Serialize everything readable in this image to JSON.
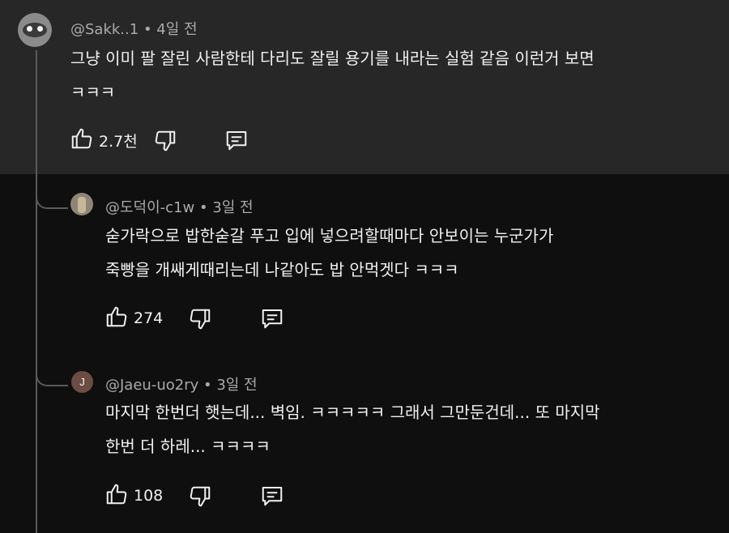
{
  "comments": [
    {
      "author": "@Sakk..1",
      "time": "• 4일 전",
      "lines": [
        "그냥 이미 팔 잘린 사람한테 다리도 잘릴 용기를 내라는 실험 같음 이런거 보면",
        "ㅋㅋㅋ"
      ],
      "likes": "2.7천"
    },
    {
      "author": "@도덕이-c1w",
      "time": "• 3일 전",
      "lines": [
        "숟가락으로  밥한숟갈 푸고 입에 넣으려할때마다 안보이는 누군가가",
        "죽빵을 개쌔게때리는데 나같아도 밥 안먹겟다 ㅋㅋㅋ"
      ],
      "likes": "274"
    },
    {
      "author": "@Jaeu-uo2ry",
      "avatar_letter": "J",
      "time": "• 3일 전",
      "lines": [
        "마지막 한번더 햇는데... 벽임. ㅋㅋㅋㅋㅋ 그래서 그만둔건데... 또 마지막",
        "한번 더 하레... ㅋㅋㅋㅋ"
      ],
      "likes": "108"
    }
  ],
  "colors": {
    "highlight_bg": "#272727",
    "page_bg": "#0f0f0f",
    "meta": "#aaaaaa",
    "text": "#f1f1f1"
  }
}
